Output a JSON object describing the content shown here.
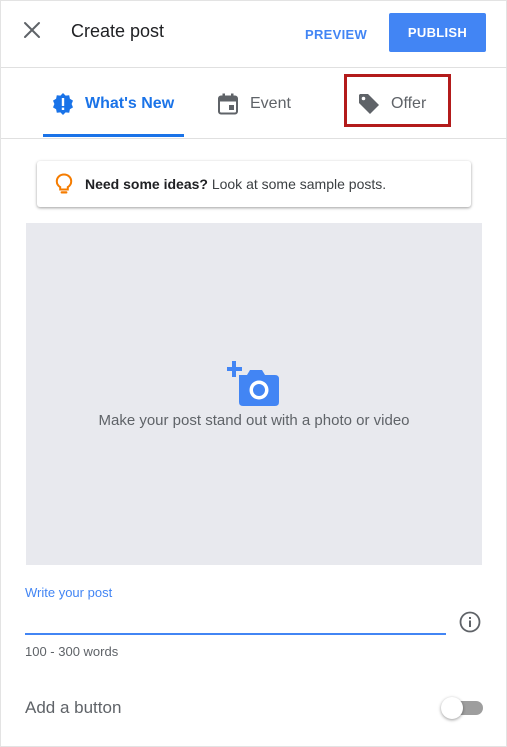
{
  "header": {
    "title": "Create post",
    "preview_label": "PREVIEW",
    "publish_label": "PUBLISH"
  },
  "tabs": [
    {
      "label": "What's New",
      "icon": "whats-new-icon",
      "selected": true
    },
    {
      "label": "Event",
      "icon": "calendar-icon",
      "selected": false
    },
    {
      "label": "Offer",
      "icon": "tag-icon",
      "selected": false
    }
  ],
  "ideas": {
    "bold": "Need some ideas?",
    "rest": " Look at some sample posts."
  },
  "media": {
    "hint": "Make your post stand out with a photo or video",
    "icon": "add-photo-icon"
  },
  "post": {
    "label": "Write your post",
    "value": "",
    "helper": "100 - 300 words"
  },
  "add_button": {
    "label": "Add a button",
    "enabled": false
  },
  "colors": {
    "accent": "#4285f4",
    "tab_active": "#1a73e8",
    "highlight": "#b31b1b",
    "bulb": "#f57c00",
    "media_bg": "#e8e9ee"
  }
}
